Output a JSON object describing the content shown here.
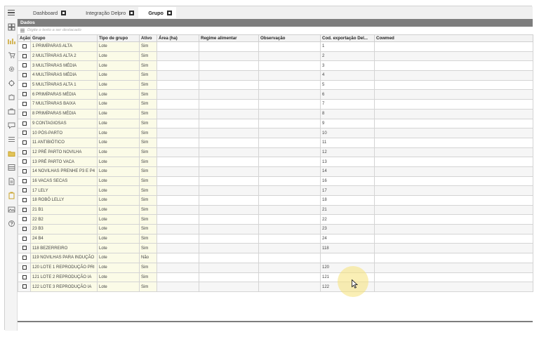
{
  "tabs": [
    {
      "label": "Dashboard",
      "active": false
    },
    {
      "label": "Integração Delpro",
      "active": false
    },
    {
      "label": "Grupo",
      "active": true
    }
  ],
  "sidebar_icons": [
    "grid-icon",
    "chart-icon",
    "cart-icon",
    "gear-icon",
    "cog-icon",
    "puzzle-icon",
    "briefcase-icon",
    "chat-icon",
    "list-icon",
    "folder-icon",
    "table-icon",
    "document-icon",
    "clipboard-icon",
    "image-icon",
    "help-icon"
  ],
  "section": {
    "title": "Dados"
  },
  "filter": {
    "placeholder": "Digite o texto a ser destacado"
  },
  "columns": {
    "acao": "Ação",
    "grupo": "Grupo",
    "tipo": "Tipo de grupo",
    "ativo": "Ativo",
    "area": "Área (ha)",
    "regime": "Regime alimentar",
    "obs": "Observação",
    "cod": "Cod. exportação Del...",
    "cowmed": "Cowmed"
  },
  "rows": [
    {
      "grupo": "1 PRIMÍPARAS ALTA",
      "tipo": "Lote",
      "ativo": "Sim",
      "cod": "1"
    },
    {
      "grupo": "2 MULTÍPARAS ALTA 2",
      "tipo": "Lote",
      "ativo": "Sim",
      "cod": "2"
    },
    {
      "grupo": "3 MULTÍPARAS MÉDIA",
      "tipo": "Lote",
      "ativo": "Sim",
      "cod": "3"
    },
    {
      "grupo": "4 MULTÍPARAS MÉDIA",
      "tipo": "Lote",
      "ativo": "Sim",
      "cod": "4"
    },
    {
      "grupo": "5 MULTÍPARAS ALTA 1",
      "tipo": "Lote",
      "ativo": "Sim",
      "cod": "5"
    },
    {
      "grupo": "6 PRIMÍPARAS MÉDIA",
      "tipo": "Lote",
      "ativo": "Sim",
      "cod": "6"
    },
    {
      "grupo": "7 MULTÍPARAS BAIXA",
      "tipo": "Lote",
      "ativo": "Sim",
      "cod": "7"
    },
    {
      "grupo": "8 PRIMÍPARAS MÉDIA",
      "tipo": "Lote",
      "ativo": "Sim",
      "cod": "8"
    },
    {
      "grupo": "9 CONTAGIOSAS",
      "tipo": "Lote",
      "ativo": "Sim",
      "cod": "9"
    },
    {
      "grupo": "10 PÓS-PARTO",
      "tipo": "Lote",
      "ativo": "Sim",
      "cod": "10"
    },
    {
      "grupo": "11 ANTIBIÓTICO",
      "tipo": "Lote",
      "ativo": "Sim",
      "cod": "11"
    },
    {
      "grupo": "12 PRÉ PARTO NOVILHA",
      "tipo": "Lote",
      "ativo": "Sim",
      "cod": "12"
    },
    {
      "grupo": "13 PRÉ PARTO VACA",
      "tipo": "Lote",
      "ativo": "Sim",
      "cod": "13"
    },
    {
      "grupo": "14 NOVILHAS PRENHE P3 E P4",
      "tipo": "Lote",
      "ativo": "Sim",
      "cod": "14"
    },
    {
      "grupo": "16 VACAS SECAS",
      "tipo": "Lote",
      "ativo": "Sim",
      "cod": "16"
    },
    {
      "grupo": "17 LELY",
      "tipo": "Lote",
      "ativo": "Sim",
      "cod": "17"
    },
    {
      "grupo": "18 ROBÔ LELLY",
      "tipo": "Lote",
      "ativo": "Sim",
      "cod": "18"
    },
    {
      "grupo": "21 B1",
      "tipo": "Lote",
      "ativo": "Sim",
      "cod": "21"
    },
    {
      "grupo": "22 B2",
      "tipo": "Lote",
      "ativo": "Sim",
      "cod": "22"
    },
    {
      "grupo": "23 B3",
      "tipo": "Lote",
      "ativo": "Sim",
      "cod": "23"
    },
    {
      "grupo": "24 B4",
      "tipo": "Lote",
      "ativo": "Sim",
      "cod": "24"
    },
    {
      "grupo": "118 BEZERREIRO",
      "tipo": "Lote",
      "ativo": "Sim",
      "cod": "118"
    },
    {
      "grupo": "119 NOVILHAS PARA INDUÇÃO",
      "tipo": "Lote",
      "ativo": "Não",
      "cod": ""
    },
    {
      "grupo": "120 LOTE 1 REPRODUÇÃO PRI",
      "tipo": "Lote",
      "ativo": "Sim",
      "cod": "120"
    },
    {
      "grupo": "121 LOTE 2 REPRODUÇÃO IA",
      "tipo": "Lote",
      "ativo": "Sim",
      "cod": "121"
    },
    {
      "grupo": "122 LOTE 3 REPRODUÇÃO IA",
      "tipo": "Lote",
      "ativo": "Sim",
      "cod": "122"
    }
  ],
  "colors": {
    "header_bar": "#7d7d7d",
    "highlight_column": "#fbfbe7",
    "cursor_highlight": "#f6e278"
  }
}
